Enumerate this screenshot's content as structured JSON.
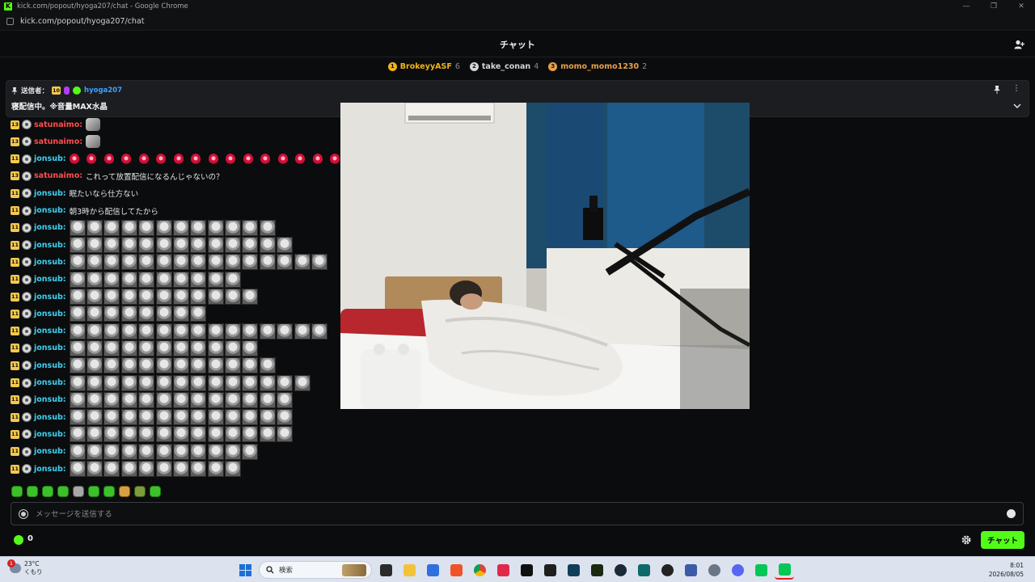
{
  "window": {
    "title": "kick.com/popout/hyoga207/chat - Google Chrome",
    "url": "kick.com/popout/hyoga207/chat",
    "controls": [
      "—",
      "❐",
      "✕"
    ]
  },
  "header": {
    "title": "チャット"
  },
  "leaderboard": [
    {
      "rank": "1",
      "name": "BrokeyyASF",
      "count": "6",
      "color": "#f2b418"
    },
    {
      "rank": "2",
      "name": "take_conan",
      "count": "4",
      "color": "#d6d6d6"
    },
    {
      "rank": "3",
      "name": "momo_momo1230",
      "count": "2",
      "color": "#e8a04a"
    }
  ],
  "pinned": {
    "label": "送信者：",
    "sub_months": "10",
    "sender": "hyoga207",
    "message": "寝配信中。※音量MAX水晶"
  },
  "colors": {
    "satunaimo": "#ff4d4d",
    "jonsub": "#3fd0f0",
    "kick_green": "#53fc18"
  },
  "messages": [
    {
      "badge": "13",
      "user": "satunaimo:",
      "color": "#ff4d4d",
      "kind": "emote",
      "count": 1,
      "emote": "small"
    },
    {
      "badge": "13",
      "user": "satunaimo:",
      "color": "#ff4d4d",
      "kind": "emote",
      "count": 1,
      "emote": "small"
    },
    {
      "badge": "11",
      "user": "jonsub:",
      "color": "#3fd0f0",
      "kind": "emote",
      "count": 16,
      "emote": "heart"
    },
    {
      "badge": "13",
      "user": "satunaimo:",
      "color": "#ff4d4d",
      "kind": "text",
      "text": "これって放置配信になるんじゃないの？"
    },
    {
      "badge": "11",
      "user": "jonsub:",
      "color": "#3fd0f0",
      "kind": "text",
      "text": "眠たいなら仕方ない"
    },
    {
      "badge": "11",
      "user": "jonsub:",
      "color": "#3fd0f0",
      "kind": "text",
      "text": "朝3時から配信してたから"
    },
    {
      "badge": "11",
      "user": "jonsub:",
      "color": "#3fd0f0",
      "kind": "emote",
      "count": 12,
      "emote": "face"
    },
    {
      "badge": "11",
      "user": "jonsub:",
      "color": "#3fd0f0",
      "kind": "emote",
      "count": 13,
      "emote": "face"
    },
    {
      "badge": "11",
      "user": "jonsub:",
      "color": "#3fd0f0",
      "kind": "emote",
      "count": 15,
      "emote": "face"
    },
    {
      "badge": "11",
      "user": "jonsub:",
      "color": "#3fd0f0",
      "kind": "emote",
      "count": 10,
      "emote": "face"
    },
    {
      "badge": "11",
      "user": "jonsub:",
      "color": "#3fd0f0",
      "kind": "emote",
      "count": 11,
      "emote": "face"
    },
    {
      "badge": "11",
      "user": "jonsub:",
      "color": "#3fd0f0",
      "kind": "emote",
      "count": 8,
      "emote": "face"
    },
    {
      "badge": "11",
      "user": "jonsub:",
      "color": "#3fd0f0",
      "kind": "emote",
      "count": 15,
      "emote": "face"
    },
    {
      "badge": "11",
      "user": "jonsub:",
      "color": "#3fd0f0",
      "kind": "emote",
      "count": 11,
      "emote": "face"
    },
    {
      "badge": "11",
      "user": "jonsub:",
      "color": "#3fd0f0",
      "kind": "emote",
      "count": 12,
      "emote": "face"
    },
    {
      "badge": "11",
      "user": "jonsub:",
      "color": "#3fd0f0",
      "kind": "emote",
      "count": 14,
      "emote": "face"
    },
    {
      "badge": "11",
      "user": "jonsub:",
      "color": "#3fd0f0",
      "kind": "emote",
      "count": 13,
      "emote": "face"
    },
    {
      "badge": "11",
      "user": "jonsub:",
      "color": "#3fd0f0",
      "kind": "emote",
      "count": 13,
      "emote": "face"
    },
    {
      "badge": "11",
      "user": "jonsub:",
      "color": "#3fd0f0",
      "kind": "emote",
      "count": 13,
      "emote": "face"
    },
    {
      "badge": "11",
      "user": "jonsub:",
      "color": "#3fd0f0",
      "kind": "emote",
      "count": 11,
      "emote": "face"
    },
    {
      "badge": "11",
      "user": "jonsub:",
      "color": "#3fd0f0",
      "kind": "emote",
      "count": 10,
      "emote": "face"
    }
  ],
  "input": {
    "placeholder": "メッセージを送信する"
  },
  "footer": {
    "points": "0",
    "send_label": "チャット"
  },
  "taskbar": {
    "weather_temp": "23°C",
    "weather_desc": "くもり",
    "notification_count": "1",
    "search_label": "検索",
    "time": "8:01",
    "date": "2026/08/05"
  }
}
